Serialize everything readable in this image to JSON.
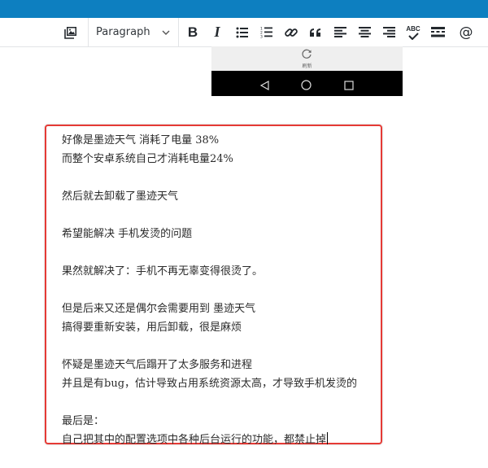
{
  "toolbar": {
    "format_select": "Paragraph",
    "buttons": [
      "add-media-icon",
      "bold-icon",
      "italic-icon",
      "bulleted-list-icon",
      "numbered-list-icon",
      "link-icon",
      "blockquote-icon",
      "align-left-icon",
      "align-center-icon",
      "align-right-icon",
      "spellcheck-icon",
      "read-more-icon",
      "at-sign-icon"
    ],
    "spellcheck_label": "ABC"
  },
  "phone_screenshot": {
    "refresh_label": "刷新",
    "nav_icons": [
      "back-triangle-icon",
      "home-circle-icon",
      "recents-square-icon"
    ]
  },
  "content": {
    "paragraphs": [
      [
        "好像是墨迹天气 消耗了电量 38%",
        "而整个安卓系统自己才消耗电量24%"
      ],
      [
        "然后就去卸载了墨迹天气"
      ],
      [
        "希望能解决 手机发烫的问题"
      ],
      [
        "果然就解决了：手机不再无辜变得很烫了。"
      ],
      [
        "但是后来又还是偶尔会需要用到 墨迹天气",
        "搞得要重新安装，用后卸载，很是麻烦"
      ],
      [
        "怀疑是墨迹天气后蹋开了太多服务和进程",
        "并且是有bug，估计导致占用系统资源太高，才导致手机发烫的"
      ],
      [
        "最后是：",
        "自己把其中的配置选项中各种后台运行的功能，都禁止掉"
      ]
    ]
  },
  "colors": {
    "top_bar": "#0d7fc0",
    "highlight_border": "#e53a35"
  }
}
